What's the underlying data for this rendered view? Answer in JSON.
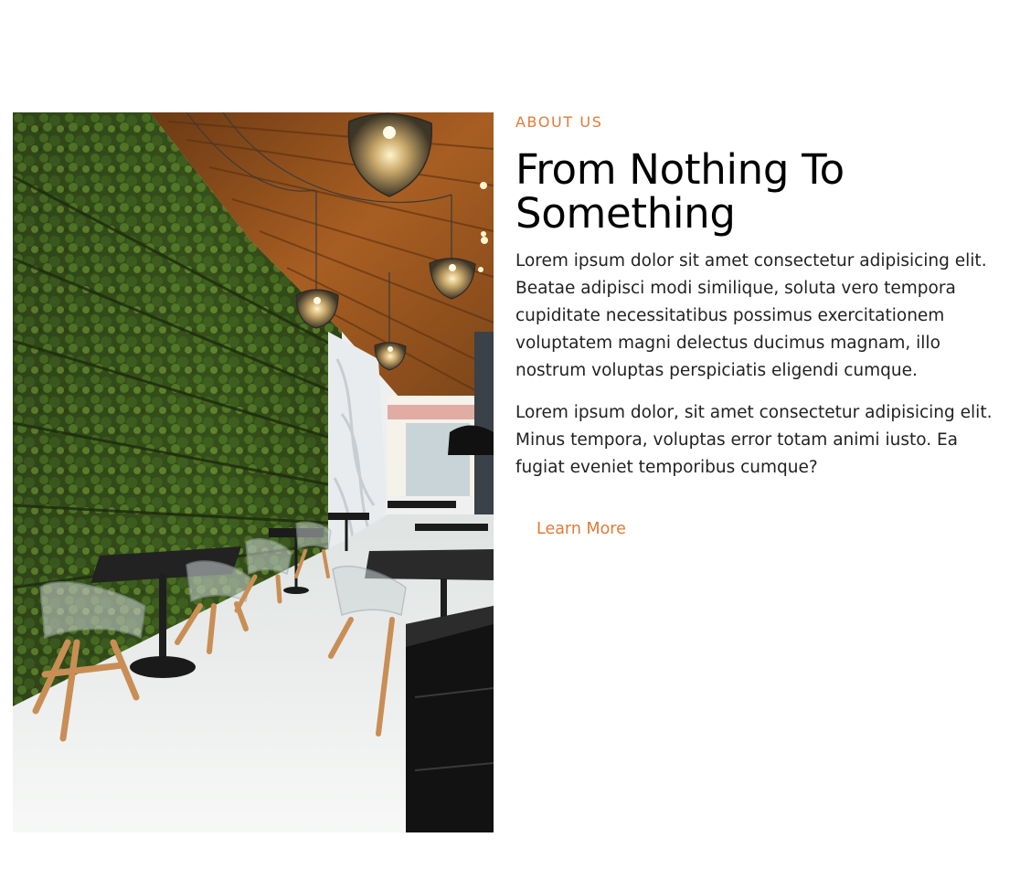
{
  "about": {
    "eyebrow": "ABOUT US",
    "title": "From Nothing To Something",
    "paragraphs": [
      "Lorem ipsum dolor sit amet consectetur adipisicing elit. Beatae adipisci modi similique, soluta vero tempora cupiditate necessitatibus possimus exercitationem voluptatem magni delectus ducimus magnam, illo nostrum voluptas perspiciatis eligendi cumque.",
      "Lorem ipsum dolor, sit amet consectetur adipisicing elit. Minus tempora, voluptas error totam animi iusto. Ea fugiat eveniet temporibus cumque?"
    ],
    "cta_label": "Learn More"
  },
  "image": {
    "subject": "cafe interior with vertical green wall, wooden ceiling and pendant lamps"
  },
  "colors": {
    "accent": "#e07b39",
    "heading": "#000000",
    "body_text": "#222222",
    "background": "#ffffff"
  }
}
